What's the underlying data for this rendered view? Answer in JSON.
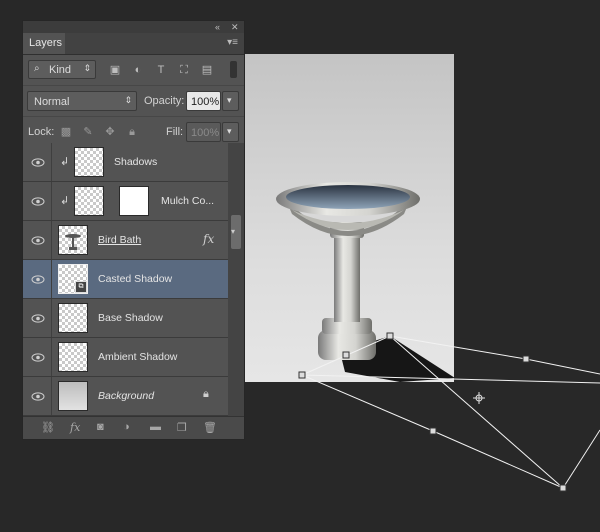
{
  "panel": {
    "collapse_icon": "double-chevron-left-icon",
    "close_icon": "close-icon",
    "tab_label": "Layers",
    "menu_icon": "panel-menu-icon"
  },
  "filter": {
    "search_icon": "search-icon",
    "kind_label": "Kind",
    "icons": [
      "pixel-filter-icon",
      "adjustment-filter-icon",
      "type-filter-icon",
      "shape-filter-icon",
      "smart-object-filter-icon"
    ]
  },
  "blend": {
    "mode": "Normal",
    "opacity_label": "Opacity:",
    "opacity_value": "100%"
  },
  "lock": {
    "label": "Lock:",
    "fill_label": "Fill:",
    "fill_value": "100%"
  },
  "layers": [
    {
      "name": "Shadows",
      "thumb": "transparent",
      "clipped": true,
      "mask": false,
      "underline": false,
      "italic": false
    },
    {
      "name": "Mulch Co...",
      "thumb": "transparent",
      "clipped": true,
      "mask": true,
      "underline": false,
      "italic": false
    },
    {
      "name": "Bird Bath",
      "thumb": "transparent",
      "clipped": false,
      "mask": false,
      "underline": true,
      "italic": false,
      "fx": "fx"
    },
    {
      "name": "Casted Shadow",
      "thumb": "transparent",
      "clipped": false,
      "mask": false,
      "underline": false,
      "italic": false,
      "selected": true
    },
    {
      "name": "Base Shadow",
      "thumb": "transparent",
      "clipped": false,
      "mask": false,
      "underline": false,
      "italic": false
    },
    {
      "name": "Ambient Shadow",
      "thumb": "transparent",
      "clipped": false,
      "mask": false,
      "underline": false,
      "italic": false
    },
    {
      "name": "Background",
      "thumb": "background",
      "clipped": false,
      "mask": false,
      "underline": false,
      "italic": true,
      "locked": true
    }
  ],
  "bottom_icons": [
    "link-layers-icon",
    "fx-icon",
    "add-mask-icon",
    "new-adjustment-icon",
    "new-group-icon",
    "new-layer-icon",
    "trash-icon"
  ],
  "canvas": {
    "subject": "bird-bath-photo",
    "transform_handles": "distort-transform-bounding-box"
  }
}
